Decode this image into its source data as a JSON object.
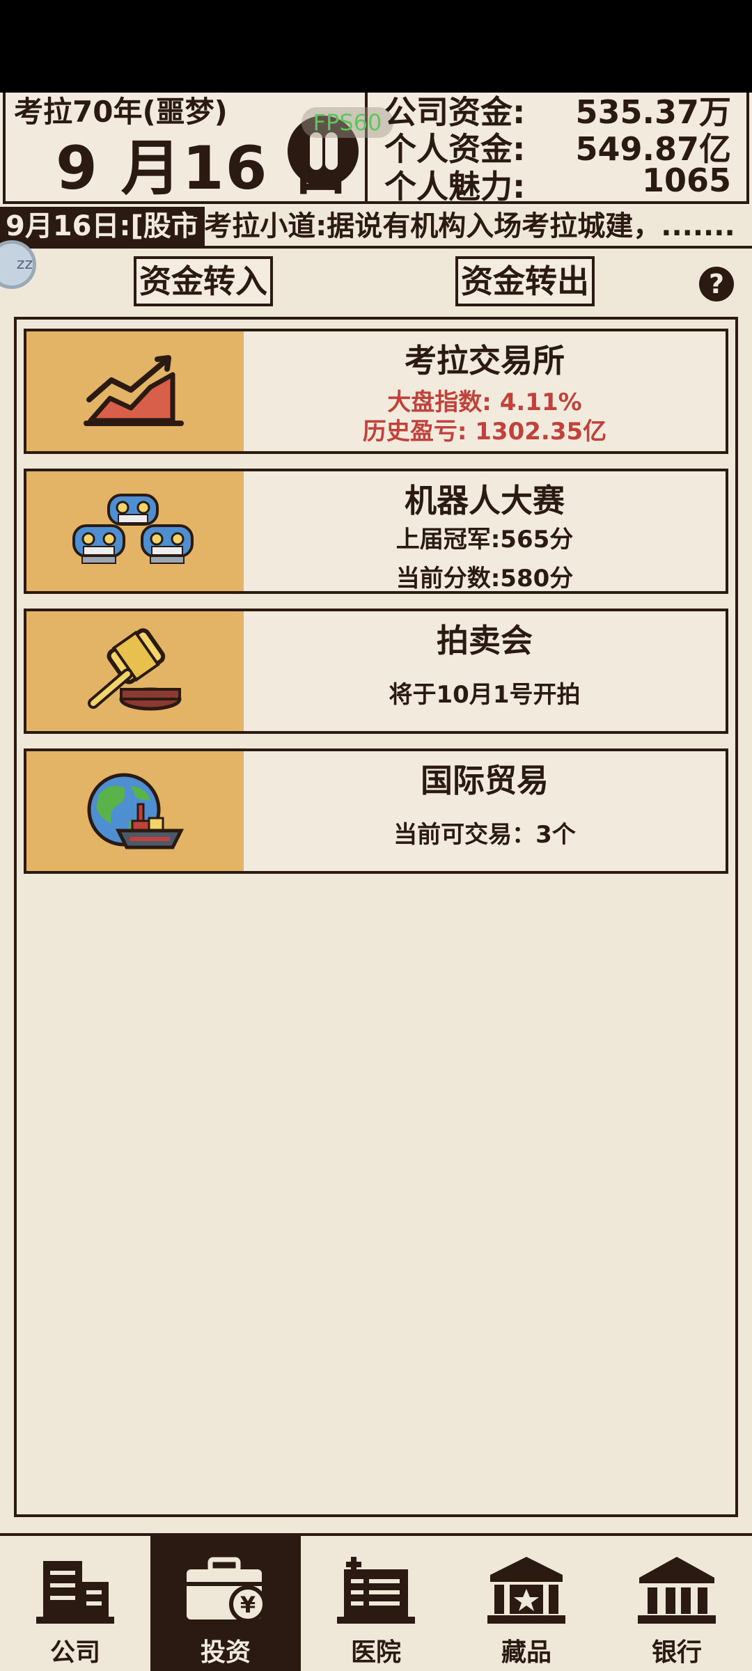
{
  "header": {
    "era": "考拉70年(噩梦)",
    "date": "9 月16 日",
    "fps": "FPS60",
    "stats": [
      {
        "label": "公司资金:",
        "value": "535.37万"
      },
      {
        "label": "个人资金:",
        "value": "549.87亿"
      },
      {
        "label": "个人魅力:",
        "value": "1065"
      }
    ]
  },
  "ticker": {
    "date": "9月16日:[股市",
    "text": "]考拉小道:据说有机构入场考拉城建，......."
  },
  "avatar_text": "zz",
  "funds": {
    "transfer_in": "资金转入",
    "transfer_out": "资金转出",
    "help": "?"
  },
  "cards": [
    {
      "title": "考拉交易所",
      "line1": "大盘指数: 4.11%",
      "line2": "历史盈亏: 1302.35亿",
      "icon": "stock-chart-icon"
    },
    {
      "title": "机器人大赛",
      "line1": "上届冠军:565分",
      "line2": "当前分数:580分",
      "icon": "robots-icon"
    },
    {
      "title": "拍卖会",
      "line1": "将于10月1号开拍",
      "icon": "gavel-icon"
    },
    {
      "title": "国际贸易",
      "line1": "当前可交易：3个",
      "icon": "globe-ship-icon"
    }
  ],
  "nav": [
    {
      "label": "公司",
      "icon": "building-icon"
    },
    {
      "label": "投资",
      "icon": "briefcase-yen-icon",
      "active": true
    },
    {
      "label": "医院",
      "icon": "hospital-icon"
    },
    {
      "label": "藏品",
      "icon": "museum-icon"
    },
    {
      "label": "银行",
      "icon": "bank-icon"
    }
  ],
  "colors": {
    "dark": "#2a1a12",
    "card_thumb": "#e3b466",
    "red": "#c0423a",
    "background": "#efe7d7"
  }
}
